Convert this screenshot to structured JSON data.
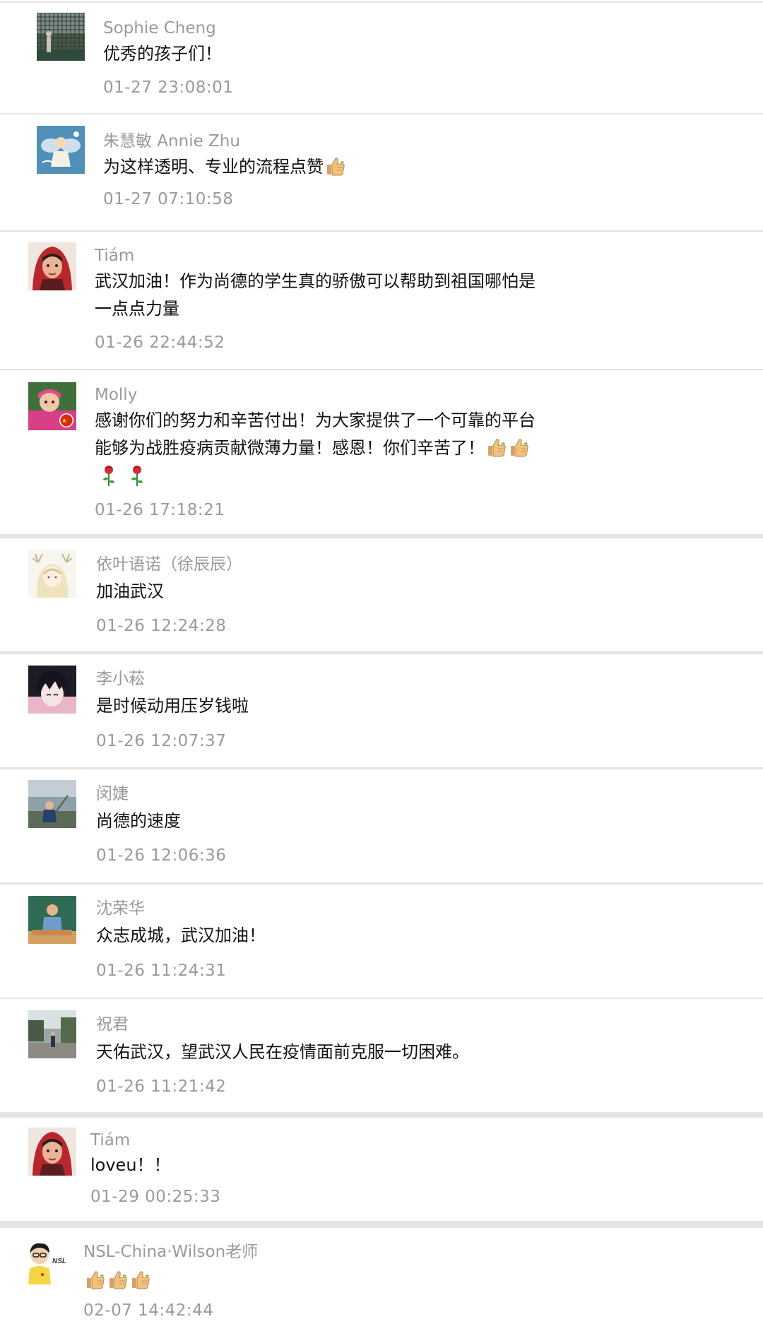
{
  "comments": [
    {
      "avatar_icon": "avatar-tennis-court-photo",
      "name": "Sophie Cheng",
      "lines": [
        "优秀的孩子们！"
      ],
      "emoji": [],
      "time": "01-27 23:08:01"
    },
    {
      "avatar_icon": "avatar-angel-cartoon",
      "name": "朱慧敏 Annie Zhu",
      "lines": [
        "为这样透明、专业的流程点赞"
      ],
      "emoji": [
        "thumbs-up-icon"
      ],
      "time": "01-27 07:10:58"
    },
    {
      "avatar_icon": "avatar-red-hood-girl",
      "name": "Tiám",
      "lines": [
        "武汉加油！作为尚德的学生真的骄傲可以帮助到祖国哪怕是",
        "一点点力量"
      ],
      "emoji": [],
      "time": "01-26 22:44:52"
    },
    {
      "avatar_icon": "avatar-girl-flag",
      "name": "Molly",
      "lines": [
        "感谢你们的努力和辛苦付出！为大家提供了一个可靠的平台",
        "能够为战胜疫病贡献微薄力量！感恩！你们辛苦了！"
      ],
      "emoji": [
        "thumbs-up-icon",
        "thumbs-up-icon"
      ],
      "extra_emoji": [
        "rose-icon",
        "rose-icon"
      ],
      "time": "01-26 17:18:21"
    },
    {
      "avatar_icon": "avatar-deer-girl-sketch",
      "name": "依叶语诺（徐辰辰）",
      "lines": [
        "加油武汉"
      ],
      "emoji": [],
      "time": "01-26 12:24:28"
    },
    {
      "avatar_icon": "avatar-anime-boy",
      "name": "李小菘",
      "lines": [
        "是时候动用压岁钱啦"
      ],
      "emoji": [],
      "time": "01-26 12:07:37"
    },
    {
      "avatar_icon": "avatar-child-outdoor",
      "name": "闵婕",
      "lines": [
        "尚德的速度"
      ],
      "emoji": [],
      "time": "01-26 12:06:36"
    },
    {
      "avatar_icon": "avatar-teacher-blackboard",
      "name": "沈荣华",
      "lines": [
        "众志成城，武汉加油！"
      ],
      "emoji": [],
      "time": "01-26 11:24:31"
    },
    {
      "avatar_icon": "avatar-park-photo",
      "name": "祝君",
      "lines": [
        "天佑武汉，望武汉人民在疫情面前克服一切困难。"
      ],
      "emoji": [],
      "time": "01-26 11:21:42"
    },
    {
      "avatar_icon": "avatar-red-hood-girl",
      "name": "Tiám",
      "lines": [
        "loveu！！"
      ],
      "emoji": [],
      "time": "01-29 00:25:33"
    },
    {
      "avatar_icon": "avatar-cartoon-teacher-nsl",
      "name": "NSL-China·Wilson老师",
      "lines": [
        ""
      ],
      "emoji": [
        "thumbs-up-icon",
        "thumbs-up-icon",
        "thumbs-up-icon"
      ],
      "time": "02-07 14:42:44"
    }
  ],
  "colors": {
    "name_gray": "#9a9a9a",
    "time_gray": "#9a9a9a",
    "text": "#111111",
    "separator": "#e4e4e4"
  }
}
